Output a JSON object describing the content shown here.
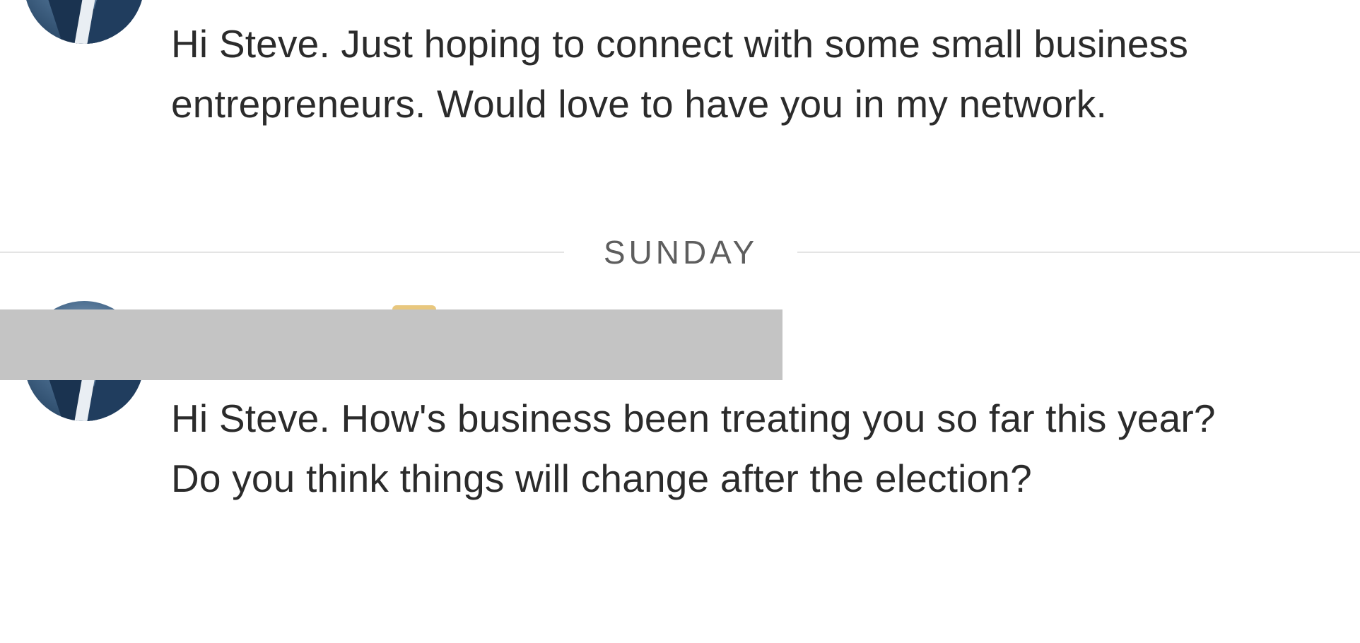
{
  "messages": [
    {
      "text": "Hi Steve. Just hoping to connect with some small business entrepreneurs. Would love to have you in my network."
    },
    {
      "text": "Hi Steve. How's business been treating you so far this year? Do you think things will change after the election?"
    }
  ],
  "divider": {
    "label": "SUNDAY"
  },
  "icons": {
    "avatar": "profile-photo-man-in-suit",
    "badge": "premium-badge-icon"
  },
  "colors": {
    "redaction": "#c4c4c4",
    "divider_line": "#e4e4e4",
    "divider_text": "#5e5e5e",
    "message_text": "#2b2b2b"
  }
}
